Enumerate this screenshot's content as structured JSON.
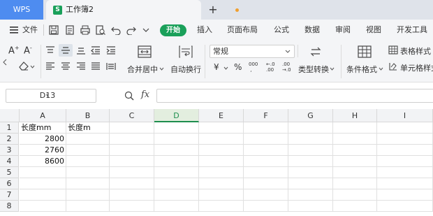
{
  "tabs": {
    "app": "WPS",
    "document": "工作簿2",
    "doc_icon": "S"
  },
  "menu": {
    "file": "文件",
    "start": "开始",
    "items": [
      "插入",
      "页面布局",
      "公式",
      "数据",
      "审阅",
      "视图",
      "开发工具"
    ]
  },
  "toolbar": {
    "merge_center": "合并居中",
    "wrap_text": "自动换行",
    "number_format": "常规",
    "type_convert": "类型转换",
    "conditional_format": "条件格式",
    "table_style": "表格样式",
    "cell_style": "单元格样式",
    "currency": "¥",
    "percent": "%",
    "thousands": "000",
    "inc_decimal": "←.0\n.00",
    "dec_decimal": ".00\n→.0"
  },
  "formula_bar": {
    "name_box": "D13",
    "fx": "fx",
    "content": ""
  },
  "sheet": {
    "columns": [
      "A",
      "B",
      "C",
      "D",
      "E",
      "F",
      "G",
      "H",
      "I"
    ],
    "selected_column": "D",
    "rows": [
      "1",
      "2",
      "3",
      "4",
      "5",
      "6",
      "7",
      "8"
    ],
    "cells": {
      "A1": "长度mm",
      "B1": "长度m",
      "A2": "2800",
      "A3": "2760",
      "A4": "8600"
    }
  },
  "colors": {
    "accent_green": "#1aa05a",
    "wps_blue": "#4e8cf0"
  }
}
